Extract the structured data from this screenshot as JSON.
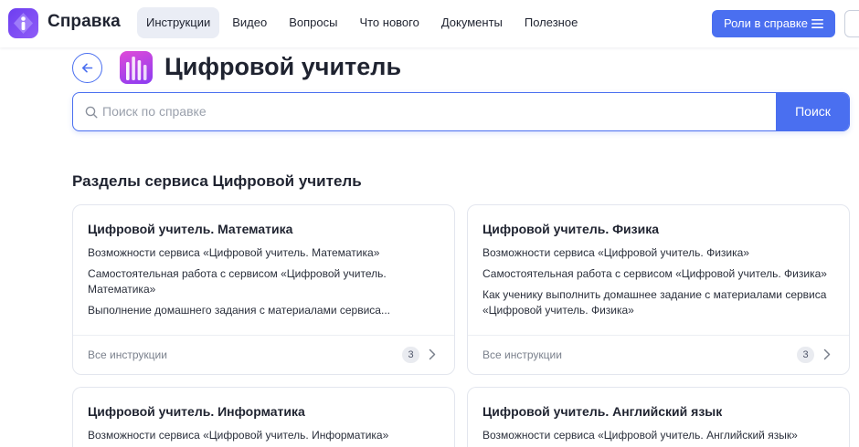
{
  "header": {
    "brand": "Справка",
    "nav": [
      {
        "label": "Инструкции",
        "active": true
      },
      {
        "label": "Видео",
        "active": false
      },
      {
        "label": "Вопросы",
        "active": false
      },
      {
        "label": "Что нового",
        "active": false
      },
      {
        "label": "Документы",
        "active": false
      },
      {
        "label": "Полезное",
        "active": false
      }
    ],
    "roles_button": "Роли в справке"
  },
  "page": {
    "title": "Цифровой учитель"
  },
  "search": {
    "placeholder": "Поиск по справке",
    "value": "",
    "button": "Поиск"
  },
  "section": {
    "title": "Разделы сервиса Цифровой учитель",
    "cards": [
      {
        "title": "Цифровой учитель. Математика",
        "links": [
          "Возможности сервиса «Цифровой учитель. Математика»",
          "Самостоятельная работа с сервисом «Цифровой учитель. Математика»",
          "Выполнение домашнего задания с материалами сервиса..."
        ],
        "footer_label": "Все инструкции",
        "count": "3"
      },
      {
        "title": "Цифровой учитель. Физика",
        "links": [
          "Возможности сервиса «Цифровой учитель. Физика»",
          "Самостоятельная работа с сервисом «Цифровой учитель. Физика»",
          "Как ученику выполнить домашнее задание с материалами сервиса «Цифровой учитель. Физика»"
        ],
        "footer_label": "Все инструкции",
        "count": "3"
      },
      {
        "title": "Цифровой учитель. Информатика",
        "links": [
          "Возможности сервиса «Цифровой учитель. Информатика»"
        ]
      },
      {
        "title": "Цифровой учитель. Английский язык",
        "links": [
          "Возможности сервиса «Цифровой учитель. Английский язык»"
        ]
      }
    ]
  },
  "colors": {
    "accent": "#4a6ff0",
    "text": "#1f2330",
    "muted": "#7a808c",
    "nav_active_bg": "#eaedf5"
  }
}
